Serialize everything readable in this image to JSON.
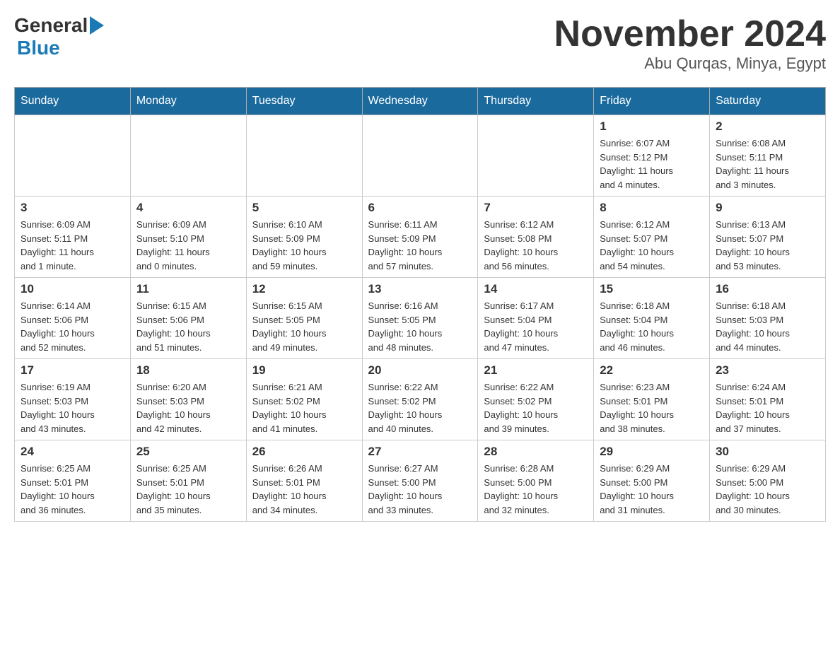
{
  "header": {
    "logo_general": "General",
    "logo_blue": "Blue",
    "month_title": "November 2024",
    "location": "Abu Qurqas, Minya, Egypt"
  },
  "days_of_week": [
    "Sunday",
    "Monday",
    "Tuesday",
    "Wednesday",
    "Thursday",
    "Friday",
    "Saturday"
  ],
  "weeks": [
    [
      {
        "day": "",
        "info": ""
      },
      {
        "day": "",
        "info": ""
      },
      {
        "day": "",
        "info": ""
      },
      {
        "day": "",
        "info": ""
      },
      {
        "day": "",
        "info": ""
      },
      {
        "day": "1",
        "info": "Sunrise: 6:07 AM\nSunset: 5:12 PM\nDaylight: 11 hours\nand 4 minutes."
      },
      {
        "day": "2",
        "info": "Sunrise: 6:08 AM\nSunset: 5:11 PM\nDaylight: 11 hours\nand 3 minutes."
      }
    ],
    [
      {
        "day": "3",
        "info": "Sunrise: 6:09 AM\nSunset: 5:11 PM\nDaylight: 11 hours\nand 1 minute."
      },
      {
        "day": "4",
        "info": "Sunrise: 6:09 AM\nSunset: 5:10 PM\nDaylight: 11 hours\nand 0 minutes."
      },
      {
        "day": "5",
        "info": "Sunrise: 6:10 AM\nSunset: 5:09 PM\nDaylight: 10 hours\nand 59 minutes."
      },
      {
        "day": "6",
        "info": "Sunrise: 6:11 AM\nSunset: 5:09 PM\nDaylight: 10 hours\nand 57 minutes."
      },
      {
        "day": "7",
        "info": "Sunrise: 6:12 AM\nSunset: 5:08 PM\nDaylight: 10 hours\nand 56 minutes."
      },
      {
        "day": "8",
        "info": "Sunrise: 6:12 AM\nSunset: 5:07 PM\nDaylight: 10 hours\nand 54 minutes."
      },
      {
        "day": "9",
        "info": "Sunrise: 6:13 AM\nSunset: 5:07 PM\nDaylight: 10 hours\nand 53 minutes."
      }
    ],
    [
      {
        "day": "10",
        "info": "Sunrise: 6:14 AM\nSunset: 5:06 PM\nDaylight: 10 hours\nand 52 minutes."
      },
      {
        "day": "11",
        "info": "Sunrise: 6:15 AM\nSunset: 5:06 PM\nDaylight: 10 hours\nand 51 minutes."
      },
      {
        "day": "12",
        "info": "Sunrise: 6:15 AM\nSunset: 5:05 PM\nDaylight: 10 hours\nand 49 minutes."
      },
      {
        "day": "13",
        "info": "Sunrise: 6:16 AM\nSunset: 5:05 PM\nDaylight: 10 hours\nand 48 minutes."
      },
      {
        "day": "14",
        "info": "Sunrise: 6:17 AM\nSunset: 5:04 PM\nDaylight: 10 hours\nand 47 minutes."
      },
      {
        "day": "15",
        "info": "Sunrise: 6:18 AM\nSunset: 5:04 PM\nDaylight: 10 hours\nand 46 minutes."
      },
      {
        "day": "16",
        "info": "Sunrise: 6:18 AM\nSunset: 5:03 PM\nDaylight: 10 hours\nand 44 minutes."
      }
    ],
    [
      {
        "day": "17",
        "info": "Sunrise: 6:19 AM\nSunset: 5:03 PM\nDaylight: 10 hours\nand 43 minutes."
      },
      {
        "day": "18",
        "info": "Sunrise: 6:20 AM\nSunset: 5:03 PM\nDaylight: 10 hours\nand 42 minutes."
      },
      {
        "day": "19",
        "info": "Sunrise: 6:21 AM\nSunset: 5:02 PM\nDaylight: 10 hours\nand 41 minutes."
      },
      {
        "day": "20",
        "info": "Sunrise: 6:22 AM\nSunset: 5:02 PM\nDaylight: 10 hours\nand 40 minutes."
      },
      {
        "day": "21",
        "info": "Sunrise: 6:22 AM\nSunset: 5:02 PM\nDaylight: 10 hours\nand 39 minutes."
      },
      {
        "day": "22",
        "info": "Sunrise: 6:23 AM\nSunset: 5:01 PM\nDaylight: 10 hours\nand 38 minutes."
      },
      {
        "day": "23",
        "info": "Sunrise: 6:24 AM\nSunset: 5:01 PM\nDaylight: 10 hours\nand 37 minutes."
      }
    ],
    [
      {
        "day": "24",
        "info": "Sunrise: 6:25 AM\nSunset: 5:01 PM\nDaylight: 10 hours\nand 36 minutes."
      },
      {
        "day": "25",
        "info": "Sunrise: 6:25 AM\nSunset: 5:01 PM\nDaylight: 10 hours\nand 35 minutes."
      },
      {
        "day": "26",
        "info": "Sunrise: 6:26 AM\nSunset: 5:01 PM\nDaylight: 10 hours\nand 34 minutes."
      },
      {
        "day": "27",
        "info": "Sunrise: 6:27 AM\nSunset: 5:00 PM\nDaylight: 10 hours\nand 33 minutes."
      },
      {
        "day": "28",
        "info": "Sunrise: 6:28 AM\nSunset: 5:00 PM\nDaylight: 10 hours\nand 32 minutes."
      },
      {
        "day": "29",
        "info": "Sunrise: 6:29 AM\nSunset: 5:00 PM\nDaylight: 10 hours\nand 31 minutes."
      },
      {
        "day": "30",
        "info": "Sunrise: 6:29 AM\nSunset: 5:00 PM\nDaylight: 10 hours\nand 30 minutes."
      }
    ]
  ]
}
